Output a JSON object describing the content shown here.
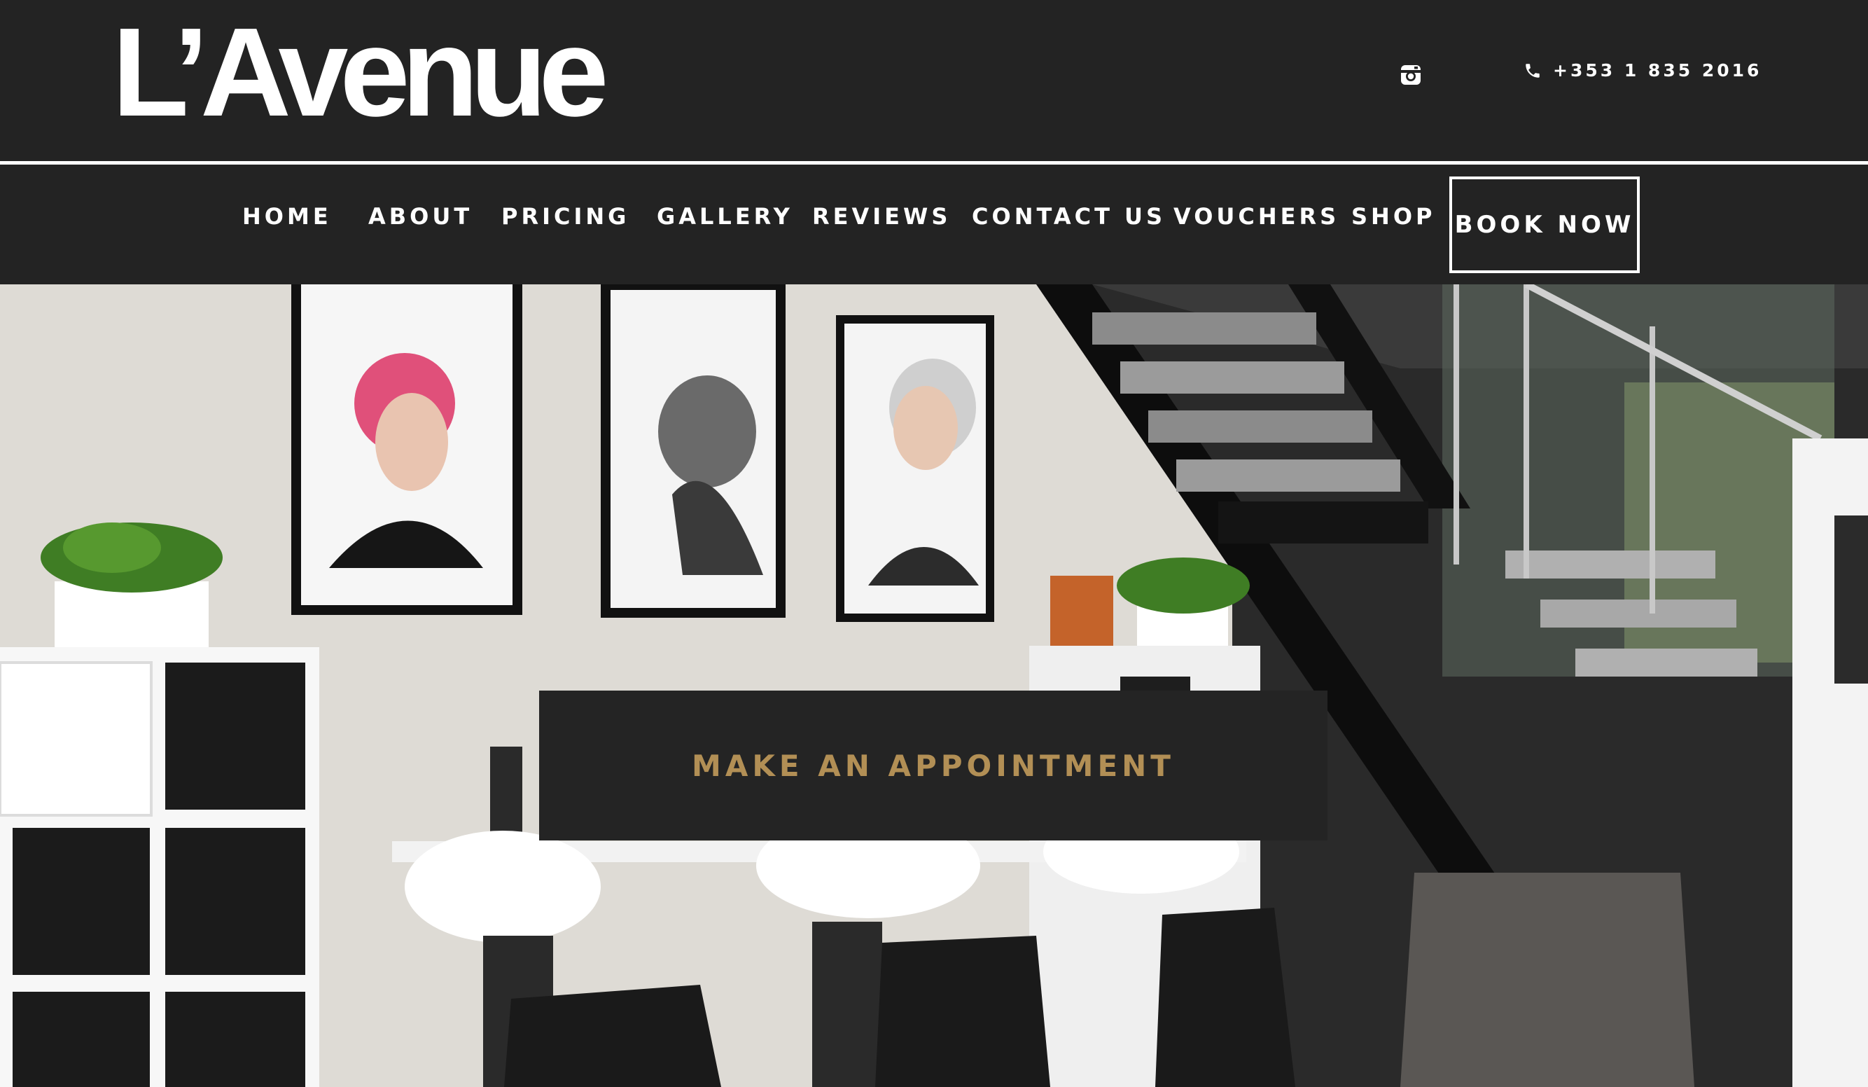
{
  "brand": {
    "logo_text": "L’Avenue"
  },
  "header": {
    "social": {
      "icon": "instagram-icon"
    },
    "phone": {
      "icon": "phone-icon",
      "number": "+353 1 835 2016"
    }
  },
  "nav": {
    "items": [
      {
        "label": "HOME"
      },
      {
        "label": "ABOUT"
      },
      {
        "label": "PRICING"
      },
      {
        "label": "GALLERY"
      },
      {
        "label": "REVIEWS"
      },
      {
        "label": "CONTACT US"
      },
      {
        "label": "VOUCHERS"
      },
      {
        "label": "SHOP"
      }
    ],
    "cta_label": "BOOK NOW"
  },
  "hero": {
    "image": "salon-interior-photo",
    "cta_label": "MAKE AN APPOINTMENT"
  },
  "colors": {
    "header_bg": "#232323",
    "text": "#ffffff",
    "accent_gold": "#b28f55"
  }
}
